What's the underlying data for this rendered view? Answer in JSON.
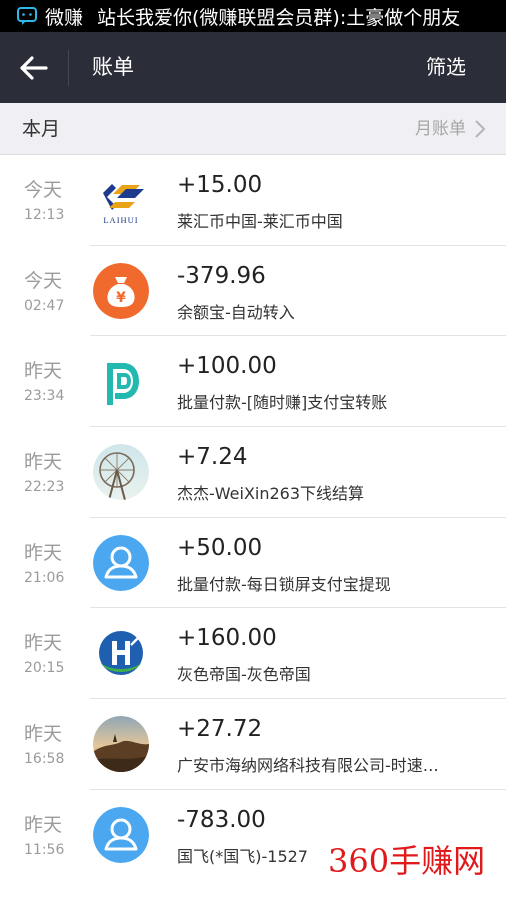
{
  "status_bar": {
    "app_name": "微赚",
    "notification": "站长我爱你(微赚联盟会员群):土豪做个朋友"
  },
  "header": {
    "back_icon": "arrow-left-icon",
    "title": "账单",
    "filter_label": "筛选"
  },
  "period": {
    "label": "本月",
    "monthly_bill_label": "月账单"
  },
  "transactions": [
    {
      "day": "今天",
      "time": "12:13",
      "amount": "+15.00",
      "desc": "莱汇币中国-莱汇币中国",
      "avatar": "laihui-logo",
      "logo_text": "LAIHUI"
    },
    {
      "day": "今天",
      "time": "02:47",
      "amount": "-379.96",
      "desc": "余额宝-自动转入",
      "avatar": "money-bag-icon",
      "logo_text": "¥"
    },
    {
      "day": "昨天",
      "time": "23:34",
      "amount": "+100.00",
      "desc": "批量付款-[随时赚]支付宝转账",
      "avatar": "suishizhuan-logo"
    },
    {
      "day": "昨天",
      "time": "22:23",
      "amount": "+7.24",
      "desc": "杰杰-WeiXin263下线结算",
      "avatar": "ferris-wheel-photo"
    },
    {
      "day": "昨天",
      "time": "21:06",
      "amount": "+50.00",
      "desc": "批量付款-每日锁屏支付宝提现",
      "avatar": "default-user-icon"
    },
    {
      "day": "昨天",
      "time": "20:15",
      "amount": "+160.00",
      "desc": "灰色帝国-灰色帝国",
      "avatar": "h-logo"
    },
    {
      "day": "昨天",
      "time": "16:58",
      "amount": "+27.72",
      "desc": "广安市海纳网络科技有限公司-时速…",
      "avatar": "landscape-photo"
    },
    {
      "day": "昨天",
      "time": "11:56",
      "amount": "-783.00",
      "desc": "国飞(*国飞)-1527",
      "avatar": "default-user-icon"
    }
  ],
  "watermark": "360手赚网",
  "colors": {
    "header_bg": "#2b2e39",
    "month_bar_bg": "#efeff4",
    "watermark": "#e0191b",
    "avatar_blue": "#4aa7f0",
    "money_orange": "#f0692d"
  }
}
